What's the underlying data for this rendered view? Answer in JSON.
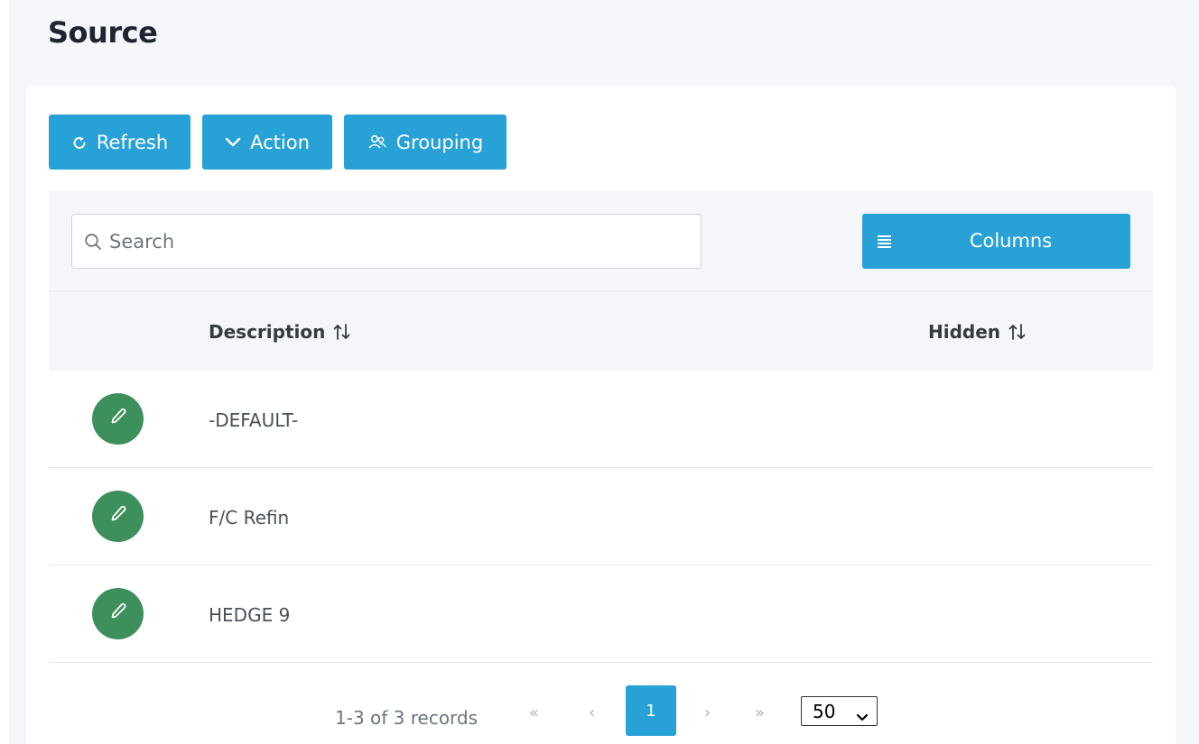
{
  "page": {
    "title": "Source"
  },
  "toolbar": {
    "refresh_label": "Refresh",
    "action_label": "Action",
    "grouping_label": "Grouping"
  },
  "search": {
    "placeholder": "Search",
    "value": ""
  },
  "columns_button": {
    "label": "Columns"
  },
  "table": {
    "headers": {
      "description": "Description",
      "hidden": "Hidden"
    },
    "rows": [
      {
        "description": "-DEFAULT-",
        "hidden": ""
      },
      {
        "description": "F/C Refin",
        "hidden": ""
      },
      {
        "description": "HEDGE 9",
        "hidden": ""
      }
    ]
  },
  "pagination": {
    "info": "1-3 of 3 records",
    "first": "«",
    "prev": "‹",
    "current_page": "1",
    "next": "›",
    "last": "»",
    "page_size": "50"
  },
  "icons": {
    "refresh": "refresh-icon",
    "action": "chevron-down-icon",
    "grouping": "users-icon",
    "search": "search-icon",
    "columns": "list-icon",
    "sort": "sort-icon",
    "edit": "pencil-icon"
  },
  "colors": {
    "primary": "#28a1d6",
    "edit_button": "#3d8f5c",
    "page_background": "#f4f6f9"
  }
}
